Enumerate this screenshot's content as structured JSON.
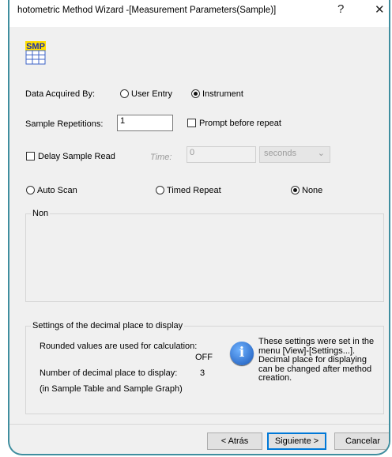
{
  "window": {
    "title": "hotometric Method Wizard -[Measurement Parameters(Sample)]",
    "help_glyph": "?",
    "close_glyph": "✕"
  },
  "icon": {
    "name": "smp-table-icon",
    "label": "SMP"
  },
  "acquired": {
    "label": "Data Acquired By:",
    "options": [
      "User Entry",
      "Instrument"
    ],
    "selected": "Instrument"
  },
  "repetitions": {
    "label": "Sample Repetitions:",
    "value": "1",
    "prompt_label": "Prompt before repeat",
    "prompt_checked": false
  },
  "delay": {
    "label": "Delay Sample Read",
    "checked": false,
    "time_label": "Time:",
    "time_value": "0",
    "unit": "seconds"
  },
  "scan_mode": {
    "options": [
      "Auto Scan",
      "Timed Repeat",
      "None"
    ],
    "selected": "None"
  },
  "group_none": {
    "label": "Non"
  },
  "decimal": {
    "title": "Settings of the decimal place to display",
    "rounded_label": "Rounded values are used for calculation:",
    "rounded_value": "OFF",
    "places_label": "Number of decimal place to display:",
    "places_value": "3",
    "scope_note": "(in Sample Table and Sample Graph)",
    "info_lines": [
      "These settings were set in the",
      "menu [View]-[Settings...].",
      "Decimal place for displaying",
      "can be changed after method",
      "creation."
    ]
  },
  "footer": {
    "back": "< Atrás",
    "next": "Siguiente >",
    "cancel": "Cancelar"
  },
  "colors": {
    "frame": "#3f8e9f",
    "default_button": "#0078d7"
  }
}
